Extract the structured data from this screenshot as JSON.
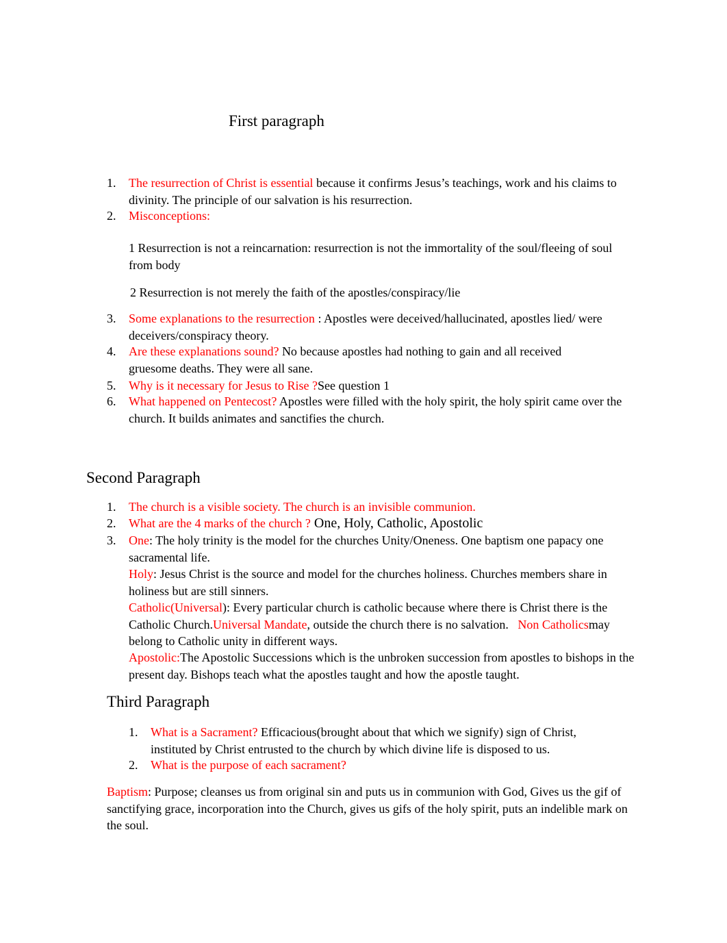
{
  "document": {
    "first": {
      "heading": "First paragraph",
      "items": [
        {
          "n": "1.",
          "q": "The resurrection of Christ is essential",
          "a": " because it confirms Jesus’s teachings, work and his claims to divinity. The principle of our salvation is his resurrection."
        },
        {
          "n": "2.",
          "q": "Misconceptions:",
          "a": ""
        },
        {
          "n": "3.",
          "q": "Some explanations to the resurrection",
          "a": "  : Apostles were deceived/hallucinated, apostles lied/ were deceivers/conspiracy theory."
        },
        {
          "n": "4.",
          "q": "Are these explanations sound?",
          "a": "  No because apostles had nothing to gain and all received gruesome deaths. They were all sane."
        },
        {
          "n": "5.",
          "q": "Why is it necessary for Jesus to Rise ?",
          "a": "See question 1"
        },
        {
          "n": "6.",
          "q": "What happened on Pentecost?",
          "a": "   Apostles were filled with the holy spirit, the holy spirit came over the church. It builds animates and sanctifies the church."
        }
      ],
      "misconceptions": [
        "1 Resurrection is not a reincarnation: resurrection is not the immortality of the soul/fleeing of soul from body",
        "2 Resurrection is not merely the faith of the apostles/conspiracy/lie"
      ]
    },
    "second": {
      "heading": "Second Paragraph",
      "items": [
        {
          "n": "1.",
          "q": "The church is a visible society. The church is an invisible communion.",
          "a": ""
        },
        {
          "n": "2.",
          "q": "What are the 4 marks of the church ?",
          "a": "  One, Holy, Catholic, Apostolic"
        },
        {
          "n": "3.",
          "q": "One",
          "a": ": The holy trinity is the model for the churches Unity/Oneness. One baptism one papacy one sacramental life."
        }
      ],
      "holy_label": "Holy",
      "holy_text": ": Jesus Christ is the source and model for the churches holiness. Churches members share in holiness but are still sinners.",
      "catholic_label": "Catholic(Universal",
      "catholic_text1": "): Every particular church is catholic because where there is Christ there is the Catholic Church.",
      "catholic_label2": "Universal Mandate",
      "catholic_text2": ", outside the church there is no salvation.   ",
      "catholic_label3": "Non Catholics",
      "catholic_text3": "may belong to Catholic unity in different ways.",
      "apostolic_label": "Apostolic:",
      "apostolic_text": "The Apostolic Successions which is the unbroken succession from apostles to bishops in the present day. Bishops teach what the apostles taught and how the apostle taught."
    },
    "third": {
      "heading": "Third Paragraph",
      "items": [
        {
          "n": "1.",
          "q": "What is a Sacrament?",
          "a": "  Efficacious(brought about that which we signify) sign of Christ, instituted by Christ entrusted to the church by which divine life is disposed to us."
        },
        {
          "n": "2.",
          "q": "What is the purpose of each sacrament?",
          "a": ""
        }
      ],
      "baptism_label": "Baptism",
      "baptism_text": ": Purpose; cleanses us from original sin and puts us in communion with God, Gives us the gif of sanctifying grace, incorporation into the Church, gives us gifs of the holy spirit, puts an indelible mark on the soul."
    }
  },
  "colors": {
    "accent": "#ff0000",
    "text": "#000000"
  }
}
